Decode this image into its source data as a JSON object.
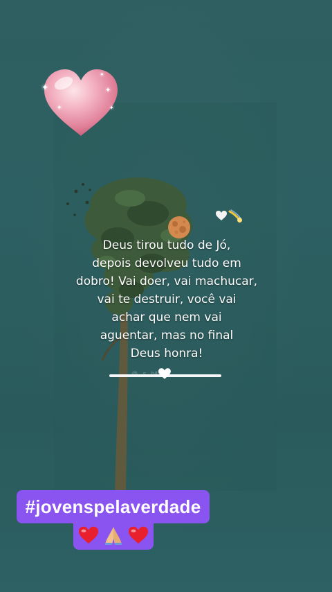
{
  "quote": {
    "lines": [
      "Deus tirou tudo de Jó,",
      "depois devolveu tudo em",
      "dobro! Vai doer, vai machucar,",
      "vai te destruir, você vai",
      "achar que nem vai",
      "aguentar, mas no final",
      "Deus honra!"
    ]
  },
  "watermark": {
    "text": "@...s...bilhete"
  },
  "hashtag": {
    "text": "#jovenspelaverdade"
  },
  "stickers": {
    "top_sticker": "pink-heart-sparkle-icon",
    "quote_decorations": [
      "white-heart-icon",
      "comet-icon",
      "full-moon-icon"
    ],
    "watermark_decoration": "white-heart-icon",
    "badge_emojis": [
      "red-heart-icon",
      "praying-hands-icon",
      "red-heart-icon"
    ]
  },
  "colors": {
    "background": "#2d6062",
    "badge": "#8a54f0",
    "heart_pink": "#f0a0b4",
    "text": "#ffffff"
  }
}
